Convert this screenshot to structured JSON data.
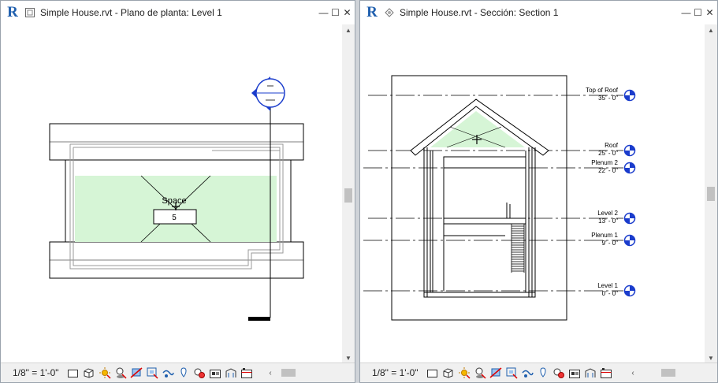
{
  "left_view": {
    "title": "Simple House.rvt - Plano de planta: Level 1",
    "space_label": "Space",
    "space_number": "5",
    "scale": "1/8\" = 1'-0\""
  },
  "right_view": {
    "title": "Simple House.rvt - Sección: Section 1",
    "scale": "1/8\" = 1'-0\"",
    "levels": [
      {
        "name": "Top of Roof",
        "elevation": "35' - 0\""
      },
      {
        "name": "Roof",
        "elevation": "25' - 0\""
      },
      {
        "name": "Plenum 2",
        "elevation": "22' - 0\""
      },
      {
        "name": "Level 2",
        "elevation": "13' - 0\""
      },
      {
        "name": "Plenum 1",
        "elevation": "9' - 0\""
      },
      {
        "name": "Level 1",
        "elevation": "0' - 0\""
      }
    ]
  },
  "icons": {
    "app": "revit-logo-icon",
    "minimize": "minimize-icon",
    "maximize": "maximize-icon",
    "close": "close-icon"
  },
  "window_buttons": {
    "minimize": "—",
    "maximize": "☐",
    "close": "✕"
  },
  "colors": {
    "space_fill": "#d6f5d6",
    "level_marker": "#1a3ccc",
    "revit_blue": "#1f5fae"
  }
}
